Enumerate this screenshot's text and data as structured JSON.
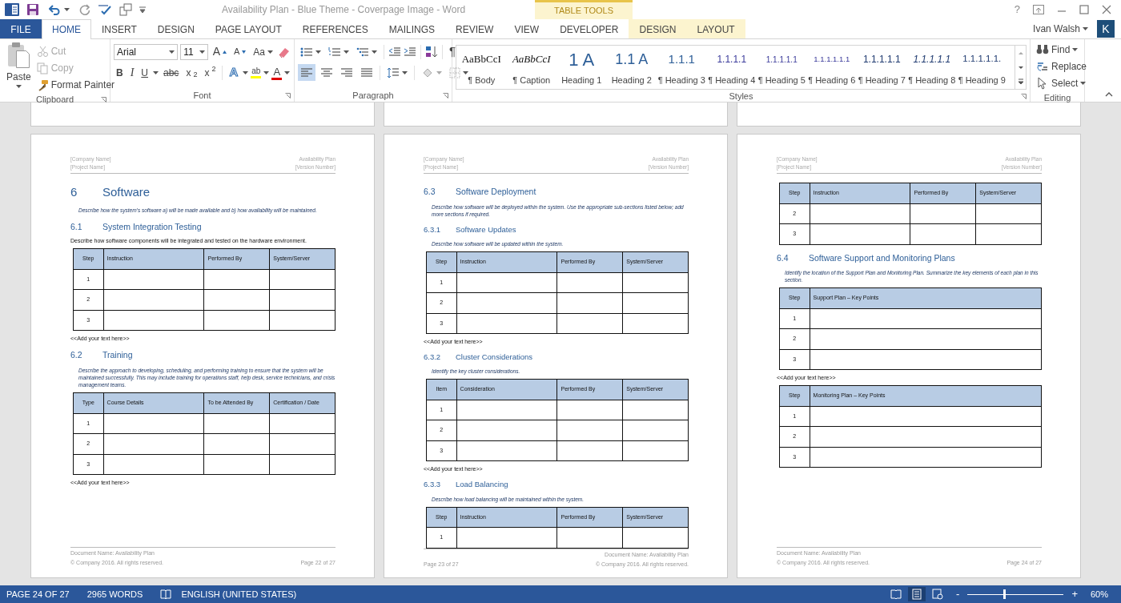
{
  "title_bar": {
    "title": "Availability Plan - Blue Theme - Coverpage Image - Word",
    "contextual_label": "TABLE TOOLS",
    "help": "?"
  },
  "tabs": [
    {
      "label": "FILE",
      "kind": "file",
      "selected": false
    },
    {
      "label": "HOME",
      "kind": "main",
      "selected": true
    },
    {
      "label": "INSERT",
      "kind": "main",
      "selected": false
    },
    {
      "label": "DESIGN",
      "kind": "main",
      "selected": false
    },
    {
      "label": "PAGE LAYOUT",
      "kind": "main",
      "selected": false
    },
    {
      "label": "REFERENCES",
      "kind": "main",
      "selected": false
    },
    {
      "label": "MAILINGS",
      "kind": "main",
      "selected": false
    },
    {
      "label": "REVIEW",
      "kind": "main",
      "selected": false
    },
    {
      "label": "VIEW",
      "kind": "main",
      "selected": false
    },
    {
      "label": "DEVELOPER",
      "kind": "main",
      "selected": false
    },
    {
      "label": "DESIGN",
      "kind": "contextual",
      "selected": false
    },
    {
      "label": "LAYOUT",
      "kind": "contextual",
      "selected": false
    }
  ],
  "account": {
    "user": "Ivan Walsh",
    "initial": "K"
  },
  "clipboard": {
    "label": "Clipboard",
    "paste": "Paste",
    "items": [
      {
        "kind": "cut",
        "label": "Cut",
        "disabled": true
      },
      {
        "kind": "copy",
        "label": "Copy",
        "disabled": true
      },
      {
        "kind": "painter",
        "label": "Format Painter",
        "disabled": false
      }
    ]
  },
  "font": {
    "label": "Font",
    "name": "Arial",
    "size": "11",
    "grow": "A",
    "shrink": "A",
    "case": "Aa",
    "formats": [
      {
        "kind": "bold",
        "label": "B"
      },
      {
        "kind": "italic",
        "label": "I"
      },
      {
        "kind": "underline",
        "label": "U"
      },
      {
        "kind": "strike",
        "label": "abc"
      },
      {
        "kind": "sub",
        "label": "x$_{2}$"
      },
      {
        "kind": "sup",
        "label": "x$^{2}$"
      }
    ],
    "effects": "A",
    "highlight": "ab",
    "text_color_label": "A"
  },
  "paragraph": {
    "label": "Paragraph",
    "marks": "¶",
    "alignments": [
      {
        "kind": "left",
        "selected": true
      },
      {
        "kind": "center",
        "selected": false
      },
      {
        "kind": "right",
        "selected": false
      },
      {
        "kind": "justify",
        "selected": false
      }
    ]
  },
  "styles": {
    "label": "Styles",
    "items": [
      {
        "kind": "body",
        "preview": "AaBbCcI",
        "name": "¶ Body"
      },
      {
        "kind": "caption",
        "preview": "AaBbCcI",
        "name": "¶ Caption"
      },
      {
        "kind": "h1",
        "preview": "1 A",
        "name": "Heading 1"
      },
      {
        "kind": "h2",
        "preview": "1.1 A",
        "name": "Heading 2"
      },
      {
        "kind": "h3",
        "preview": "1.1.1",
        "name": "¶ Heading 3"
      },
      {
        "kind": "h4",
        "preview": "1.1.1.1",
        "name": "¶ Heading 4"
      },
      {
        "kind": "h5",
        "preview": "1.1.1.1.1",
        "name": "¶ Heading 5"
      },
      {
        "kind": "h6",
        "preview": "1.1.1.1.1.1",
        "name": "¶ Heading 6"
      },
      {
        "kind": "h7",
        "preview": "1.1.1.1.1",
        "name": "¶ Heading 7"
      },
      {
        "kind": "h8",
        "preview": "1.1.1.1.1",
        "name": "¶ Heading 8"
      },
      {
        "kind": "h9",
        "preview": "1.1.1.1.1.",
        "name": "¶ Heading 9"
      }
    ]
  },
  "editing": {
    "label": "Editing",
    "items": [
      {
        "kind": "find",
        "label": "Find"
      },
      {
        "kind": "replace",
        "label": "Replace"
      },
      {
        "kind": "select",
        "label": "Select"
      }
    ]
  },
  "pages": [
    {
      "header": {
        "company": "[Company Name]",
        "project": "[Project Name]",
        "doc": "Availability Plan",
        "version": "[Version Number]"
      },
      "blocks": [
        {
          "kind": "heading1",
          "number": "6",
          "text": "Software"
        },
        {
          "kind": "instruction",
          "text": "Describe how the system’s software a) will be made available and b) how availability will be maintained."
        },
        {
          "kind": "heading2",
          "number": "6.1",
          "text": "System Integration Testing"
        },
        {
          "kind": "body",
          "text": "Describe how software components will be integrated and tested on the hardware environment."
        },
        {
          "kind": "table",
          "columns": [
            "Step",
            "Instruction",
            "Performed By",
            "System/Server"
          ],
          "rows": [
            [
              "1"
            ],
            [
              "2"
            ],
            [
              "3"
            ]
          ]
        },
        {
          "kind": "body",
          "text": "<<Add your text here>>"
        },
        {
          "kind": "heading2",
          "number": "6.2",
          "text": "Training"
        },
        {
          "kind": "instruction",
          "text": "Describe the approach to developing, scheduling, and performing training to ensure that the system will be maintained successfully. This may include training for operations staff, help desk, service technicians, and crisis management teams."
        },
        {
          "kind": "table",
          "columns": [
            "Type",
            "Course Details",
            "To be Attended By",
            "Certification / Date"
          ],
          "rows": [
            [
              "1"
            ],
            [
              "2"
            ],
            [
              "3"
            ]
          ]
        },
        {
          "kind": "body",
          "text": "<<Add your text here>>"
        }
      ],
      "footer": {
        "doc_name": "Document Name: Availability Plan",
        "copyright": "© Company 2016. All rights reserved.",
        "page": "Page 22 of 27",
        "kind": "page_right"
      }
    },
    {
      "header": {
        "company": "[Company Name]",
        "project": "[Project Name]",
        "doc": "Availability Plan",
        "version": "[Version Number]"
      },
      "blocks": [
        {
          "kind": "heading2",
          "number": "6.3",
          "text": "Software Deployment"
        },
        {
          "kind": "instruction",
          "text": "Describe how software will be deployed within the system. Use the appropriate sub-sections listed below; add more sections if required."
        },
        {
          "kind": "heading3",
          "number": "6.3.1",
          "text": "Software Updates"
        },
        {
          "kind": "instruction",
          "text": "Describe how software will be updated within the system."
        },
        {
          "kind": "table",
          "columns": [
            "Step",
            "Instruction",
            "Performed By",
            "System/Server"
          ],
          "rows": [
            [
              "1"
            ],
            [
              "2"
            ],
            [
              "3"
            ]
          ]
        },
        {
          "kind": "body",
          "text": "<<Add your text here>>"
        },
        {
          "kind": "heading3",
          "number": "6.3.2",
          "text": "Cluster Considerations"
        },
        {
          "kind": "instruction",
          "text": "Identify the key cluster considerations."
        },
        {
          "kind": "table",
          "columns": [
            "Item",
            "Consideration",
            "Performed By",
            "System/Server"
          ],
          "rows": [
            [
              "1"
            ],
            [
              "2"
            ],
            [
              "3"
            ]
          ]
        },
        {
          "kind": "body",
          "text": "<<Add your text here>>"
        },
        {
          "kind": "heading3",
          "number": "6.3.3",
          "text": "Load Balancing"
        },
        {
          "kind": "instruction",
          "text": "Describe how load balancing will be maintained within the system."
        },
        {
          "kind": "table",
          "columns": [
            "Step",
            "Instruction",
            "Performed By",
            "System/Server"
          ],
          "rows": [
            [
              "1"
            ]
          ]
        }
      ],
      "footer": {
        "doc_name": "Document Name: Availability Plan",
        "copyright": "© Company 2016. All rights reserved.",
        "page": "Page 23 of 27",
        "kind": "page_left"
      }
    },
    {
      "header": {
        "company": "[Company Name]",
        "project": "[Project Name]",
        "doc": "Availability Plan",
        "version": "[Version Number]"
      },
      "blocks": [
        {
          "kind": "table",
          "columns": [
            "Step",
            "Instruction",
            "Performed By",
            "System/Server"
          ],
          "rows": [
            [
              "2"
            ],
            [
              "3"
            ]
          ]
        },
        {
          "kind": "heading2",
          "number": "6.4",
          "text": "Software Support and Monitoring Plans"
        },
        {
          "kind": "instruction",
          "text": "Identify the location of the Support Plan and Monitoring Plan. Summarize the key elements of each plan in this section."
        },
        {
          "kind": "table",
          "columns": [
            "Step",
            "Support Plan – Key Points"
          ],
          "rows": [
            [
              "1"
            ],
            [
              "2"
            ],
            [
              "3"
            ]
          ]
        },
        {
          "kind": "body",
          "text": "<<Add your text here>>"
        },
        {
          "kind": "table",
          "columns": [
            "Step",
            "Monitoring Plan – Key Points"
          ],
          "rows": [
            [
              "1"
            ],
            [
              "2"
            ],
            [
              "3"
            ]
          ]
        }
      ],
      "footer": {
        "doc_name": "Document Name: Availability Plan",
        "copyright": "© Company 2016. All rights reserved.",
        "page": "Page 24 of 27",
        "kind": "page_right"
      }
    }
  ],
  "status_bar": {
    "page": "PAGE 24 OF 27",
    "words": "2965 WORDS",
    "language": "ENGLISH (UNITED STATES)",
    "views": [
      {
        "kind": "read",
        "selected": false
      },
      {
        "kind": "print",
        "selected": true
      },
      {
        "kind": "web",
        "selected": false
      }
    ],
    "zoom_out": "-",
    "zoom_in": "+",
    "zoom": {
      "level": 0.38
    },
    "zoom_label": "60%"
  }
}
